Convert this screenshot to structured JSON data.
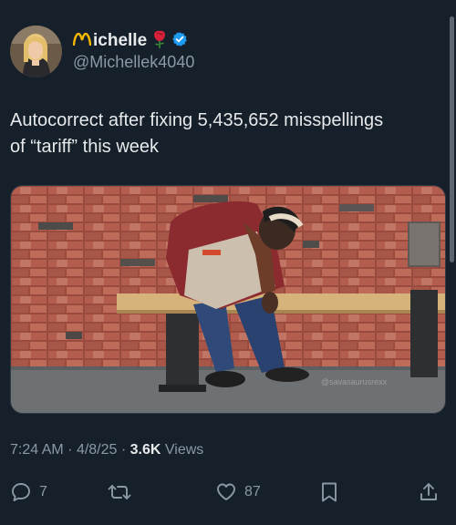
{
  "author": {
    "display_name": "ichelle",
    "handle": "@Michellek4040",
    "avatar_icon": "avatar-photo",
    "name_icons": [
      "golden-arches-icon",
      "rose-icon",
      "verified-badge-icon"
    ],
    "verified_color": "#1d9bf0"
  },
  "tweet": {
    "text_line1": "Autocorrect after fixing 5,435,652 misspellings",
    "text_line2": "of “tariff” this week"
  },
  "media": {
    "watermark": "@savasaurusrexx"
  },
  "meta": {
    "time": "7:24 AM",
    "date": "4/8/25",
    "views_count": "3.6K",
    "views_label": "Views"
  },
  "actions": {
    "replies": "7",
    "reposts": "",
    "likes": "87"
  },
  "colors": {
    "background": "#15202b",
    "text": "#e7e9ea",
    "muted": "#8b98a5"
  }
}
